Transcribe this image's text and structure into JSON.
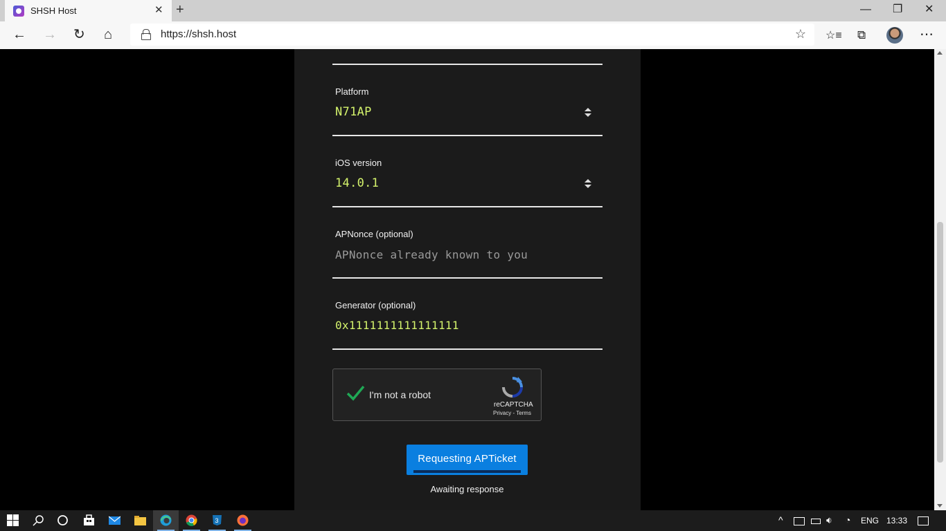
{
  "browser": {
    "tab_title": "SHSH Host",
    "tab_close": "✕",
    "new_tab": "+",
    "url": "https://shsh.host",
    "win_minimize": "—",
    "win_restore": "❐",
    "win_close": "✕",
    "back": "←",
    "forward": "→",
    "refresh": "↻",
    "home": "⌂",
    "favorite_star": "☆",
    "favorites": "☆≡",
    "collections": "⧉",
    "more": "⋯"
  },
  "form": {
    "platform": {
      "label": "Platform",
      "value": "N71AP"
    },
    "ios_version": {
      "label": "iOS version",
      "value": "14.0.1"
    },
    "apnonce": {
      "label": "APNonce (optional)",
      "placeholder": "APNonce already known to you"
    },
    "generator": {
      "label": "Generator (optional)",
      "value": "0x1111111111111111"
    },
    "captcha": {
      "label": "I'm not a robot",
      "brand": "reCAPTCHA",
      "links": "Privacy - Terms"
    },
    "submit_label": "Requesting APTicket",
    "status_text": "Awaiting response"
  },
  "taskbar": {
    "icons": [
      "windows-start-icon",
      "search-icon",
      "cortana-icon",
      "store-icon",
      "mail-icon",
      "file-explorer-icon",
      "edge-icon",
      "chrome-icon",
      "css3-icon",
      "firefox-icon"
    ],
    "language": "ENG",
    "time": "13:33"
  },
  "colors": {
    "accent": "#0a7fe0",
    "value_text": "#d4f36c",
    "panel_bg": "#1b1b1b"
  }
}
